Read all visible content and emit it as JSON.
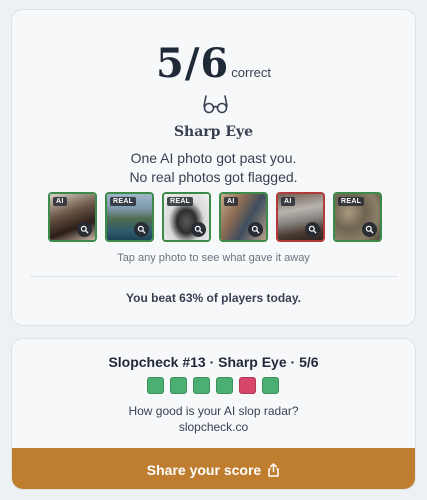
{
  "result": {
    "score": "5/6",
    "score_suffix": "correct",
    "rank_icon": "glasses-icon",
    "rank_title": "Sharp Eye",
    "summary_line1": "One AI photo got past you.",
    "summary_line2": "No real photos got flagged.",
    "tap_hint": "Tap any photo to see what gave it away",
    "beat_text": "You beat 63% of players today."
  },
  "photos": [
    {
      "tag": "AI",
      "outcome": "correct",
      "subject": "woman holding phone",
      "icon": "magnifier-icon"
    },
    {
      "tag": "REAL",
      "outcome": "correct",
      "subject": "mountain lake",
      "icon": "magnifier-icon"
    },
    {
      "tag": "REAL",
      "outcome": "correct",
      "subject": "toy car",
      "icon": "magnifier-icon"
    },
    {
      "tag": "AI",
      "outcome": "correct",
      "subject": "people at table",
      "icon": "magnifier-icon"
    },
    {
      "tag": "AI",
      "outcome": "wrong",
      "subject": "old television",
      "icon": "magnifier-icon"
    },
    {
      "tag": "REAL",
      "outcome": "correct",
      "subject": "rocky ground",
      "icon": "magnifier-icon"
    }
  ],
  "share": {
    "title": "Slopcheck #13 · Sharp Eye · 5/6",
    "squares": [
      "green",
      "green",
      "green",
      "green",
      "red",
      "green"
    ],
    "question": "How good is your AI slop radar?",
    "url": "slopcheck.co",
    "button_label": "Share your score",
    "button_icon": "share-icon"
  },
  "colors": {
    "correct": "#3d8b4a",
    "wrong": "#b23a3a",
    "square_green": "#4caf72",
    "square_red": "#d6466a",
    "accent": "#bf7e2f"
  }
}
